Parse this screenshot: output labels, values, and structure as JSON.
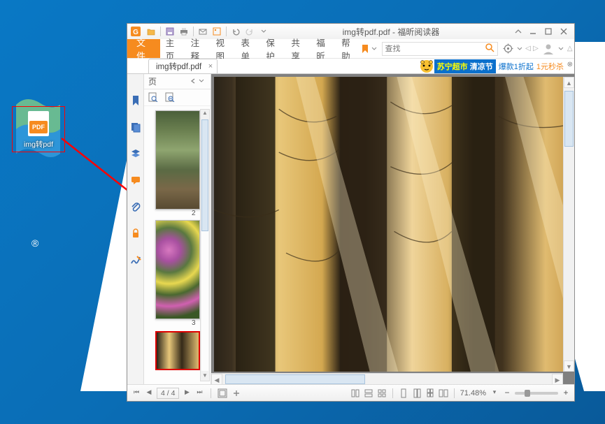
{
  "desktop": {
    "icon_label": "img转pdf",
    "icon_badge": "PDF"
  },
  "window": {
    "title": "img转pdf.pdf - 福昕阅读器",
    "file_tab": "文件",
    "menu": [
      "主页",
      "注释",
      "视图",
      "表单",
      "保护",
      "共享",
      "福昕",
      "帮助"
    ],
    "search_placeholder": "查找",
    "doc_tab": "img转pdf.pdf",
    "ad": {
      "part1_a": "苏宁超市",
      "part1_b": "清凉节",
      "part2": "爆款1折起",
      "part3": "1元秒杀"
    },
    "thumb_panel_title": "页",
    "thumbs": [
      {
        "num": "2"
      },
      {
        "num": "3"
      }
    ],
    "page_indicator": "4 / 4",
    "zoom": "71.48%",
    "brand_glyph": "®"
  }
}
